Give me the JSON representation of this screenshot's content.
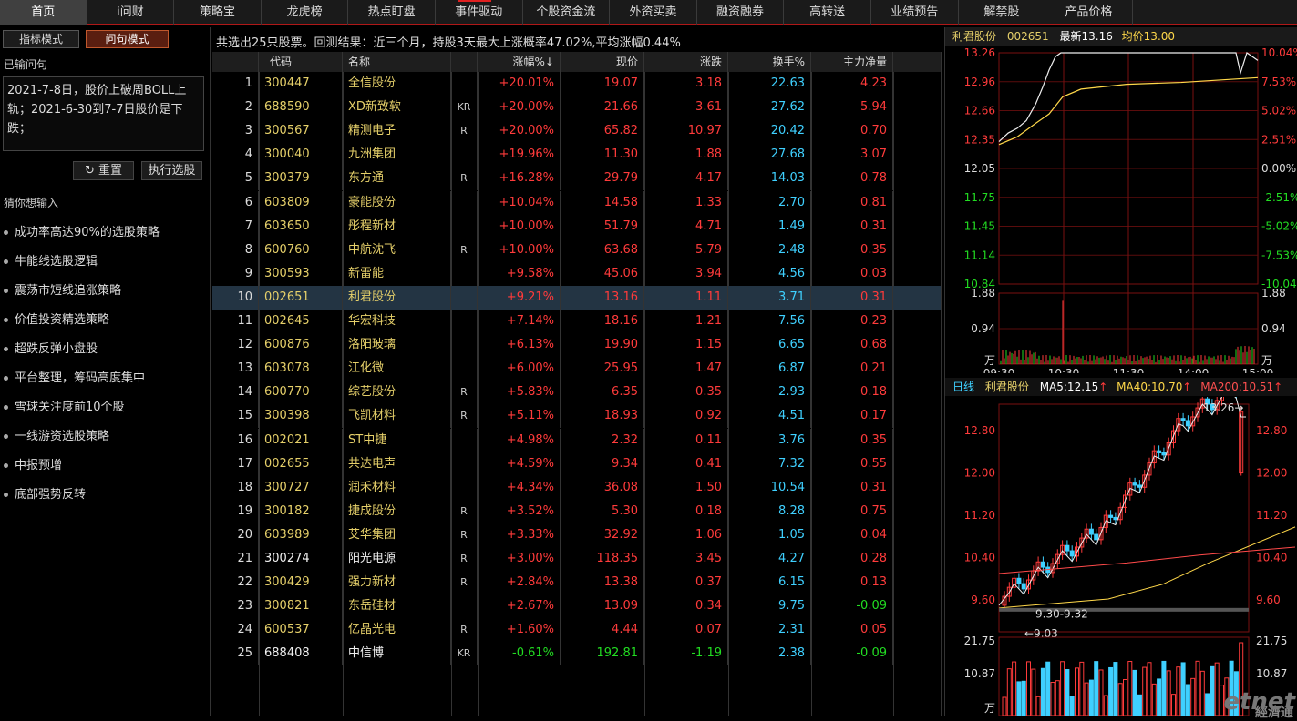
{
  "nav": [
    "首页",
    "i问财",
    "策略宝",
    "龙虎榜",
    "热点盯盘",
    "事件驱动",
    "个股资金流",
    "外资买卖",
    "融资融券",
    "高转送",
    "业绩预告",
    "解禁股",
    "产品价格"
  ],
  "left": {
    "mode_indicator": "指标模式",
    "mode_question": "问句模式",
    "entered_label": "已输问句",
    "query": "2021-7-8日，股价上破周BOLL上轨；2021-6-30到7-7日股价是下跌；",
    "reset": "重置",
    "run": "执行选股",
    "guess_label": "猜你想输入",
    "suggestions": [
      "成功率高达90%的选股策略",
      "牛能线选股逻辑",
      "震荡市短线追涨策略",
      "价值投资精选策略",
      "超跌反弹小盘股",
      "平台整理，筹码高度集中",
      "雪球关注度前10个股",
      "一线游资选股策略",
      "中报预增",
      "底部强势反转"
    ]
  },
  "summary": "共选出25只股票。回测结果：近三个月，持股3天最大上涨概率47.02%,平均涨幅0.44%",
  "table": {
    "headers": [
      "代码",
      "名称",
      "",
      "涨幅%↓",
      "现价",
      "涨跌",
      "换手%",
      "主力净量"
    ],
    "rows": [
      [
        "1",
        "300447",
        "全信股份",
        "",
        "+20.01%",
        "19.07",
        "3.18",
        "22.63",
        "4.23"
      ],
      [
        "2",
        "688590",
        "XD新致软",
        "KR",
        "+20.00%",
        "21.66",
        "3.61",
        "27.62",
        "5.94"
      ],
      [
        "3",
        "300567",
        "精测电子",
        "R",
        "+20.00%",
        "65.82",
        "10.97",
        "20.42",
        "0.70"
      ],
      [
        "4",
        "300040",
        "九洲集团",
        "",
        "+19.96%",
        "11.30",
        "1.88",
        "27.68",
        "3.07"
      ],
      [
        "5",
        "300379",
        "东方通",
        "R",
        "+16.28%",
        "29.79",
        "4.17",
        "14.03",
        "0.78"
      ],
      [
        "6",
        "603809",
        "豪能股份",
        "",
        "+10.04%",
        "14.58",
        "1.33",
        "2.70",
        "0.81"
      ],
      [
        "7",
        "603650",
        "彤程新材",
        "",
        "+10.00%",
        "51.79",
        "4.71",
        "1.49",
        "0.31"
      ],
      [
        "8",
        "600760",
        "中航沈飞",
        "R",
        "+10.00%",
        "63.68",
        "5.79",
        "2.48",
        "0.35"
      ],
      [
        "9",
        "300593",
        "新雷能",
        "",
        "+9.58%",
        "45.06",
        "3.94",
        "4.56",
        "0.03"
      ],
      [
        "10",
        "002651",
        "利君股份",
        "",
        "+9.21%",
        "13.16",
        "1.11",
        "3.71",
        "0.31"
      ],
      [
        "11",
        "002645",
        "华宏科技",
        "",
        "+7.14%",
        "18.16",
        "1.21",
        "7.56",
        "0.23"
      ],
      [
        "12",
        "600876",
        "洛阳玻璃",
        "",
        "+6.13%",
        "19.90",
        "1.15",
        "6.65",
        "0.68"
      ],
      [
        "13",
        "603078",
        "江化微",
        "",
        "+6.00%",
        "25.95",
        "1.47",
        "6.87",
        "0.21"
      ],
      [
        "14",
        "600770",
        "综艺股份",
        "R",
        "+5.83%",
        "6.35",
        "0.35",
        "2.93",
        "0.18"
      ],
      [
        "15",
        "300398",
        "飞凯材料",
        "R",
        "+5.11%",
        "18.93",
        "0.92",
        "4.51",
        "0.17"
      ],
      [
        "16",
        "002021",
        "ST中捷",
        "",
        "+4.98%",
        "2.32",
        "0.11",
        "3.76",
        "0.35"
      ],
      [
        "17",
        "002655",
        "共达电声",
        "",
        "+4.59%",
        "9.34",
        "0.41",
        "7.32",
        "0.55"
      ],
      [
        "18",
        "300727",
        "润禾材料",
        "",
        "+4.34%",
        "36.08",
        "1.50",
        "10.54",
        "0.31"
      ],
      [
        "19",
        "300182",
        "捷成股份",
        "R",
        "+3.52%",
        "5.30",
        "0.18",
        "8.28",
        "0.75"
      ],
      [
        "20",
        "603989",
        "艾华集团",
        "R",
        "+3.33%",
        "32.92",
        "1.06",
        "1.05",
        "0.04"
      ],
      [
        "21",
        "300274",
        "阳光电源",
        "R",
        "+3.00%",
        "118.35",
        "3.45",
        "4.27",
        "0.28"
      ],
      [
        "22",
        "300429",
        "强力新材",
        "R",
        "+2.84%",
        "13.38",
        "0.37",
        "6.15",
        "0.13"
      ],
      [
        "23",
        "300821",
        "东岳硅材",
        "",
        "+2.67%",
        "13.09",
        "0.34",
        "9.75",
        "-0.09"
      ],
      [
        "24",
        "600537",
        "亿晶光电",
        "R",
        "+1.60%",
        "4.44",
        "0.07",
        "2.31",
        "0.05"
      ],
      [
        "25",
        "688408",
        "中信博",
        "KR",
        "-0.61%",
        "192.81",
        "-1.19",
        "2.38",
        "-0.09"
      ]
    ]
  },
  "intraday": {
    "name": "利君股份",
    "code": "002651",
    "latest_label": "最新13.16",
    "avg_label": "均价13.00",
    "price_ticks": [
      "13.26",
      "12.96",
      "12.66",
      "12.35",
      "12.05",
      "11.75",
      "11.45",
      "11.14",
      "10.84"
    ],
    "pct_ticks": [
      "10.04%",
      "7.53%",
      "5.02%",
      "2.51%",
      "0.00%",
      "-2.51%",
      "-5.02%",
      "-7.53%",
      "-10.04%"
    ],
    "vol_ticks": [
      "1.88",
      "0.94",
      "万"
    ],
    "time_ticks": [
      "09:30",
      "10:30",
      "11:30",
      "14:00",
      "15:00"
    ]
  },
  "daily": {
    "label": "日线",
    "name": "利君股份",
    "ma5": "MA5:12.15",
    "ma40": "MA40:10.70",
    "ma200": "MA200:10.51",
    "price_ticks": [
      "12.80",
      "12.00",
      "11.20",
      "10.40",
      "9.60"
    ],
    "high_note": "13.26→",
    "low_note": "←9.03",
    "range_note": "9.30-9.32",
    "vol_ticks": [
      "21.75",
      "10.87",
      "万"
    ]
  },
  "watermark": "etnet",
  "watermark2": "經濟通",
  "colors": {
    "up": "#ff3b3b",
    "down": "#22dd22",
    "code": "#e6d06a",
    "turnover": "#3fd0ff",
    "accent": "#b01818"
  }
}
